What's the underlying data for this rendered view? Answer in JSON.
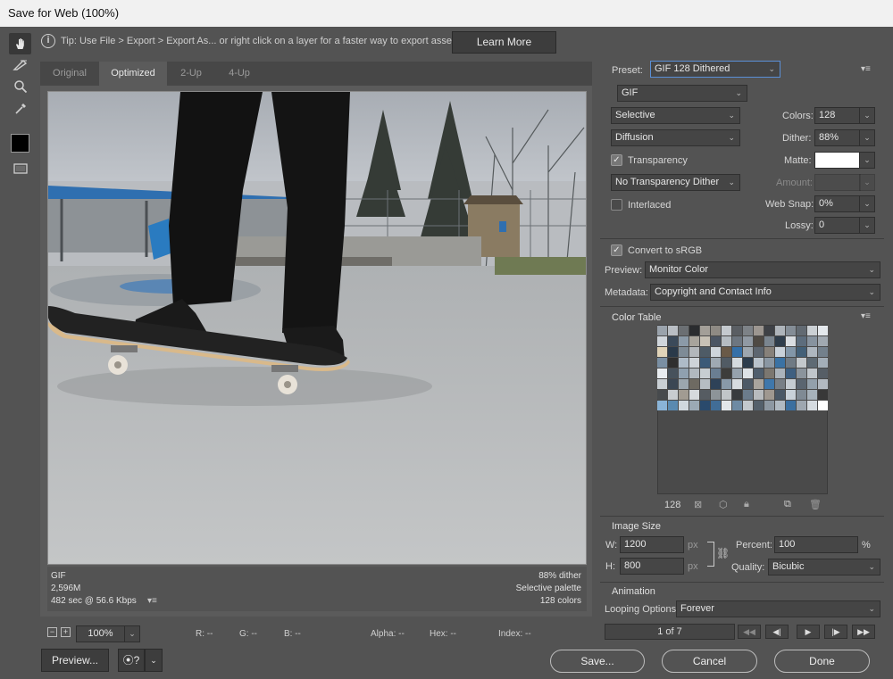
{
  "window": {
    "title": "Save for Web (100%)"
  },
  "tools": [
    {
      "name": "hand-tool-icon",
      "glyph": "✋"
    },
    {
      "name": "slice-select-tool-icon",
      "glyph": "✎"
    },
    {
      "name": "zoom-tool-icon",
      "glyph": "⌕"
    },
    {
      "name": "eyedropper-tool-icon",
      "glyph": "⟋"
    }
  ],
  "tip": {
    "icon": "info-icon",
    "text": "Tip: Use File > Export > Export As...  or right click on a layer for a faster way to export assets",
    "learn_more": "Learn More"
  },
  "tabs": [
    "Original",
    "Optimized",
    "2-Up",
    "4-Up"
  ],
  "active_tab": "Optimized",
  "image_info": {
    "format": "GIF",
    "size": "2,596M",
    "time": "482 sec @ 56.6 Kbps",
    "dither": "88% dither",
    "palette": "Selective palette",
    "colors": "128 colors"
  },
  "statusbar": {
    "zoom": "100%",
    "r": "R: --",
    "g": "G: --",
    "b": "B: --",
    "alpha": "Alpha: --",
    "hex": "Hex: --",
    "index": "Index: --"
  },
  "settings": {
    "preset_label": "Preset:",
    "preset_value": "GIF 128 Dithered",
    "format": "GIF",
    "reduction": "Selective",
    "dither_algo": "Diffusion",
    "transparency_label": "Transparency",
    "transparency_checked": true,
    "transparency_dither": "No Transparency Dither",
    "interlaced_label": "Interlaced",
    "interlaced_checked": false,
    "colors_label": "Colors:",
    "colors_value": "128",
    "dither_label": "Dither:",
    "dither_value": "88%",
    "matte_label": "Matte:",
    "amount_label": "Amount:",
    "websnap_label": "Web Snap:",
    "websnap_value": "0%",
    "lossy_label": "Lossy:",
    "lossy_value": "0",
    "convert_label": "Convert to sRGB",
    "convert_checked": true,
    "preview_label": "Preview:",
    "preview_value": "Monitor Color",
    "metadata_label": "Metadata:",
    "metadata_value": "Copyright and Contact Info"
  },
  "color_table": {
    "title": "Color Table",
    "count": "128",
    "swatches": [
      "#9aa3ac",
      "#b9bec4",
      "#6b6f73",
      "#2a2c2f",
      "#a39f98",
      "#8e8a84",
      "#c4c9ce",
      "#5a5e63",
      "#7d8287",
      "#9c9690",
      "#3e4146",
      "#aeb4ba",
      "#848d96",
      "#626a72",
      "#cbd0d4",
      "#e4e8ec",
      "#d0d6dc",
      "#3b4a5a",
      "#8b9aa8",
      "#a8a49c",
      "#c7c1b5",
      "#4b5563",
      "#b5bcc2",
      "#6d7680",
      "#9099a3",
      "#4f4a44",
      "#7a858f",
      "#2f3d4b",
      "#d9dde1",
      "#5d6d7d",
      "#87939f",
      "#a1a9b1",
      "#e0d3b8",
      "#2a3a4a",
      "#7e8b96",
      "#b3b7bb",
      "#4e5b66",
      "#cfd5db",
      "#6a5a48",
      "#3570a8",
      "#9da6ae",
      "#5d6670",
      "#87817a",
      "#c9d1d9",
      "#8296a8",
      "#436078",
      "#aeb7c0",
      "#73808c",
      "#7a8fa3",
      "#2f2f2f",
      "#aebbc7",
      "#ced3d8",
      "#3c5a78",
      "#9fa9b2",
      "#515b64",
      "#d4dade",
      "#2c3c4c",
      "#b8c2cb",
      "#8a97a3",
      "#3a72a4",
      "#6f7a84",
      "#c3c8cc",
      "#5e6a74",
      "#a3aeb8",
      "#e8ecf0",
      "#47525c",
      "#8fa0af",
      "#b0b8bf",
      "#c7cdd2",
      "#6a7e92",
      "#3d3d3b",
      "#96a2ad",
      "#dde2e6",
      "#4f5e6d",
      "#7b7770",
      "#aab3bb",
      "#3e5f80",
      "#8b949c",
      "#c0c6cb",
      "#565e66",
      "#c9cfd4",
      "#3b4754",
      "#9ba6af",
      "#6e6a62",
      "#b6bdc3",
      "#2e4258",
      "#8899a8",
      "#d8dcdf",
      "#4d5965",
      "#a9a49d",
      "#3f77ab",
      "#787f86",
      "#c5ccd2",
      "#5a6570",
      "#93a0ab",
      "#b2b9c0",
      "#474a4d",
      "#c8ccd0",
      "#a19b92",
      "#d6dadd",
      "#565c62",
      "#8d9499",
      "#c1c5c8",
      "#383b3e",
      "#6b7c8c",
      "#b7bbbe",
      "#9f9890",
      "#4a5866",
      "#c8d1d9",
      "#7f8a94",
      "#a6b1ba",
      "#383838",
      "#8ab4d8",
      "#5a8ab0",
      "#d0d8de",
      "#9ba9b5",
      "#2a4a6c",
      "#416d96",
      "#e3e7ea",
      "#6e8aa3",
      "#c2c8cd",
      "#54606b",
      "#8d98a2",
      "#b0bac2",
      "#3b6f9f",
      "#9ea7b0",
      "#d5dbe0",
      "#ffffff"
    ]
  },
  "image_size": {
    "title": "Image Size",
    "w_label": "W:",
    "w_value": "1200",
    "h_label": "H:",
    "h_value": "800",
    "unit": "px",
    "percent_label": "Percent:",
    "percent_value": "100",
    "percent_unit": "%",
    "quality_label": "Quality:",
    "quality_value": "Bicubic"
  },
  "animation": {
    "title": "Animation",
    "looping_label": "Looping Options:",
    "looping_value": "Forever",
    "frame_counter": "1 of 7"
  },
  "buttons": {
    "preview": "Preview...",
    "save": "Save...",
    "cancel": "Cancel",
    "done": "Done"
  }
}
